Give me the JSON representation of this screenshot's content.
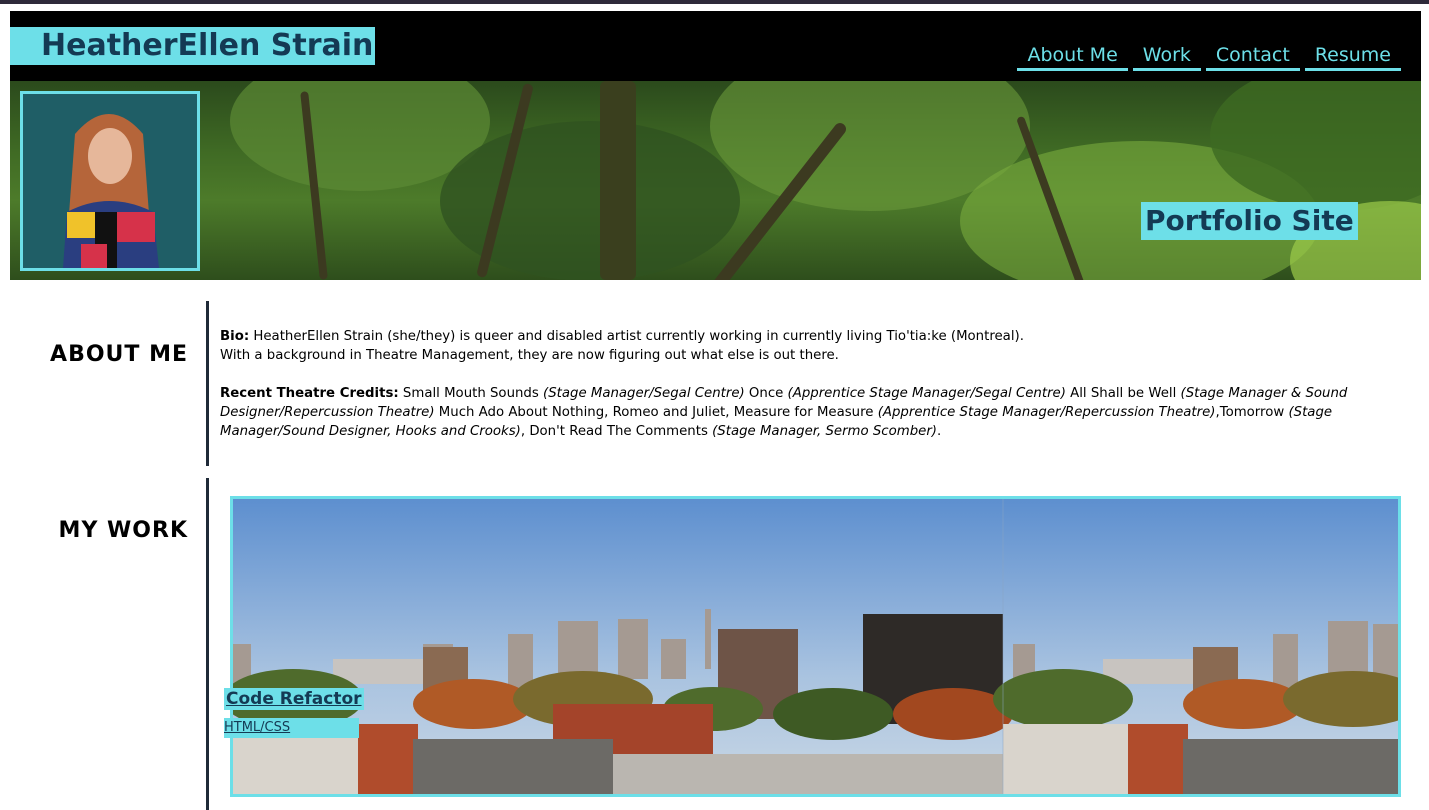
{
  "header": {
    "site_title": "HeatherEllen Strain",
    "nav": [
      "About Me",
      "Work",
      "Contact",
      "Resume"
    ]
  },
  "hero": {
    "label": "Portfolio Site"
  },
  "about": {
    "heading": "ABOUT ME",
    "bio_label": "Bio:",
    "bio_line1": " HeatherEllen Strain (she/they) is queer and disabled artist currently working in currently living Tio'tia:ke (Montreal).",
    "bio_line2": "With a background in Theatre Management, they are now figuring out what else is out there.",
    "credits_label": "Recent Theatre Credits:",
    "credits": [
      {
        "t": " Small Mouth Sounds ",
        "i": "(Stage Manager/Segal Centre)"
      },
      {
        "t": " Once ",
        "i": "(Apprentice Stage Manager/Segal Centre)"
      },
      {
        "t": " All Shall be Well ",
        "i": "(Stage Manager & Sound Designer/Repercussion Theatre)"
      },
      {
        "t": " Much Ado About Nothing, Romeo and Juliet, Measure for Measure ",
        "i": "(Apprentice Stage Manager/Repercussion Theatre)"
      },
      {
        "t": ",Tomorrow ",
        "i": "(Stage Manager/Sound Designer, Hooks and Crooks)"
      },
      {
        "t": ", Don't Read The Comments ",
        "i": "(Stage Manager, Sermo Scomber)"
      },
      {
        "t": ".",
        "i": ""
      }
    ]
  },
  "work": {
    "heading": "MY WORK",
    "project_title": "Code Refactor",
    "project_sub": "HTML/CSS"
  },
  "colors": {
    "accent": "#6ddfe8",
    "accent_text": "#143a54",
    "header_bg": "#000000"
  }
}
